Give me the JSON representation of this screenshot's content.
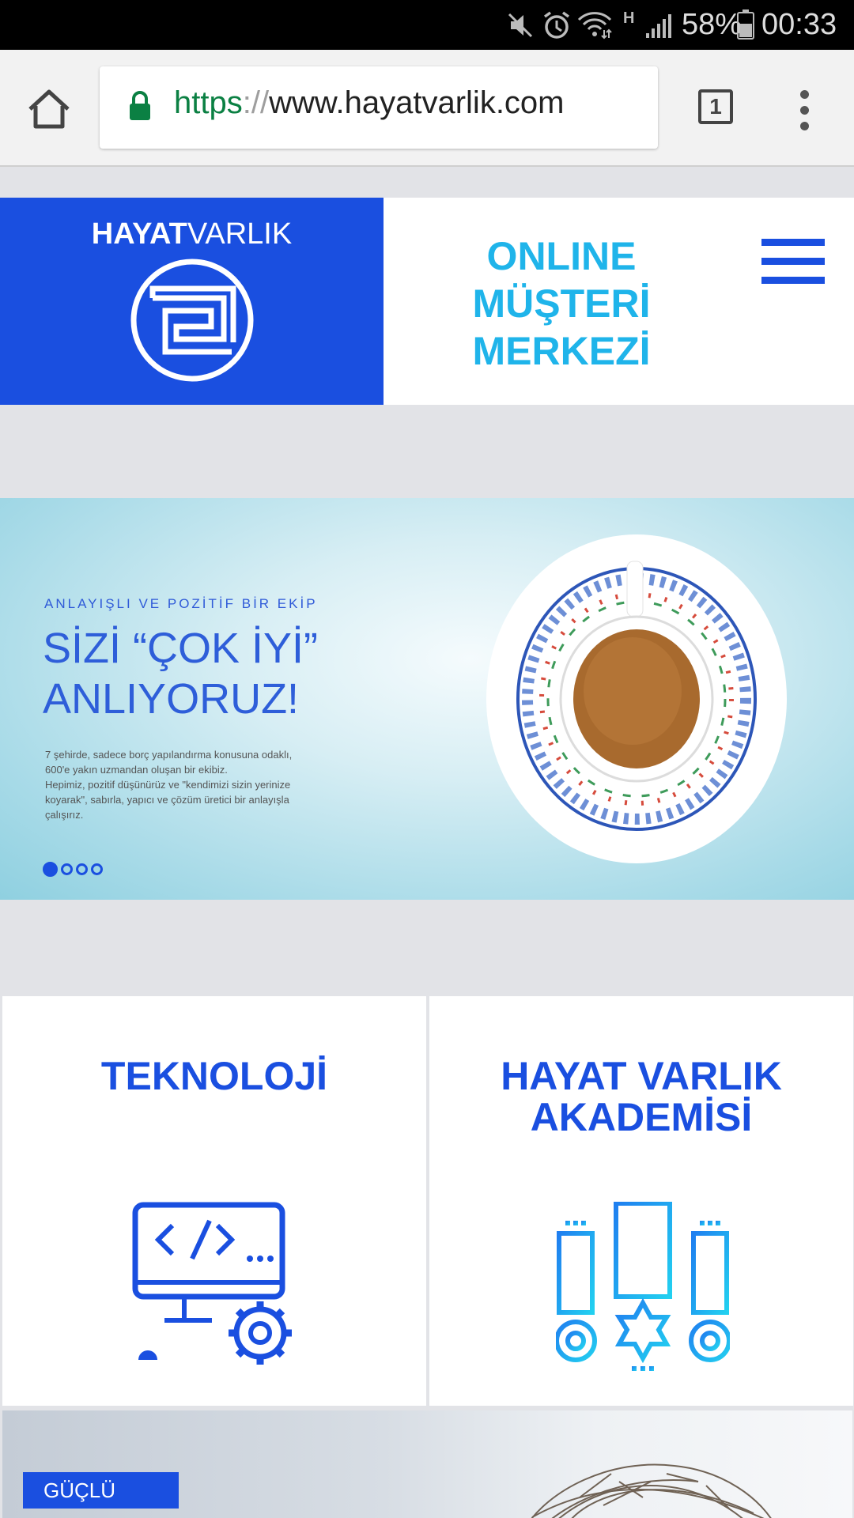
{
  "status_bar": {
    "battery_percent": "58%",
    "time": "00:33",
    "network_type": "H",
    "icons": [
      "mute-icon",
      "alarm-icon",
      "wifi-icon",
      "signal-icon",
      "battery-icon"
    ]
  },
  "browser": {
    "url_scheme": "https",
    "url_separator": "://",
    "url_host": "www.hayatvarlik.com",
    "tab_count": "1",
    "icons": [
      "home-icon",
      "lock-icon",
      "tabs-icon",
      "overflow-menu-icon"
    ]
  },
  "header": {
    "logo_bold": "HAYAT",
    "logo_light": "VARLIK",
    "tagline_line1": "ONLINE",
    "tagline_line2": "MÜŞTERİ",
    "tagline_line3": "MERKEZİ",
    "colors": {
      "brand_blue": "#1a4fe0",
      "tagline_cyan": "#1fb4ea"
    }
  },
  "hero": {
    "kicker": "ANLAYIŞLI VE POZİTİF BİR EKİP",
    "title_line1": "SİZİ “ÇOK İYİ”",
    "title_line2": "ANLIYORUZ!",
    "body_line1": "7 şehirde, sadece borç yapılandırma konusuna odaklı,",
    "body_line2": "600'e yakın uzmandan oluşan bir ekibiz.",
    "body_line3": "Hepimiz, pozitif düşünürüz ve \"kendimizi sizin yerinize",
    "body_line4": "koyarak\", sabırla, yapıcı ve çözüm üretici bir anlayışla",
    "body_line5": "çalışırız.",
    "slide_count": 4,
    "active_slide": 1
  },
  "cards": [
    {
      "title": "TEKNOLOJİ",
      "icon": "code-monitor-gear-icon"
    },
    {
      "title_line1": "HAYAT VARLIK",
      "title_line2": "AKADEMİSİ",
      "icon": "medals-icon"
    }
  ],
  "bottom_banner": {
    "badge": "GÜÇLÜ"
  }
}
